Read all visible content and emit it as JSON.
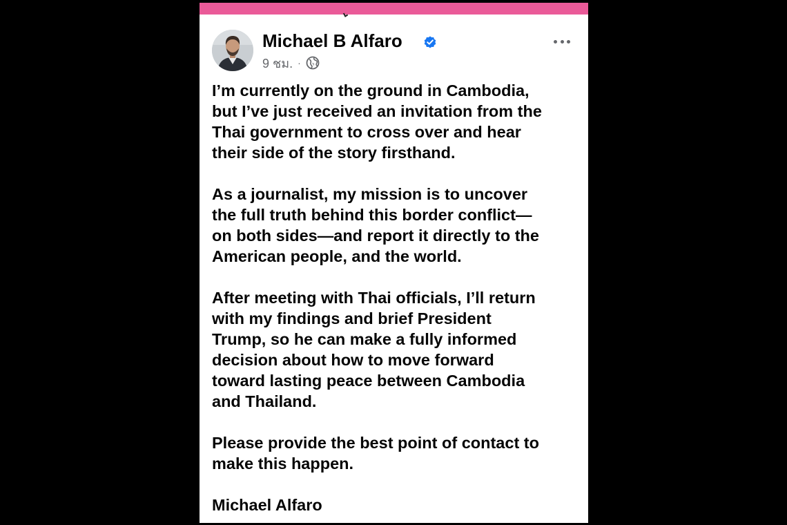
{
  "post": {
    "author": "Michael B Alfaro",
    "time": "9 ชม.",
    "separator": "·",
    "audience_icon": "globe-icon",
    "more_icon": "more-options-icon",
    "verified_icon": "verified-badge-icon",
    "paragraphs": [
      "I’m currently on the ground in Cambodia,\nbut I’ve just received an invitation from the\nThai government to cross over and hear\ntheir side of the story firsthand.",
      "As a journalist, my mission is to uncover\nthe full truth behind this border conflict—\non both sides—and report it directly to the\nAmerican people, and the world.",
      "After meeting with Thai officials, I’ll return\nwith my findings and brief President\nTrump, so he can make a fully informed\ndecision about how to move forward\ntoward lasting peace between Cambodia\nand Thailand.",
      "Please provide the best point of contact to\nmake this happen.",
      "Michael Alfaro"
    ]
  },
  "colors": {
    "top_bar": "#ea5a98",
    "verified": "#1877f2",
    "text": "#050505",
    "meta": "#65676b"
  }
}
